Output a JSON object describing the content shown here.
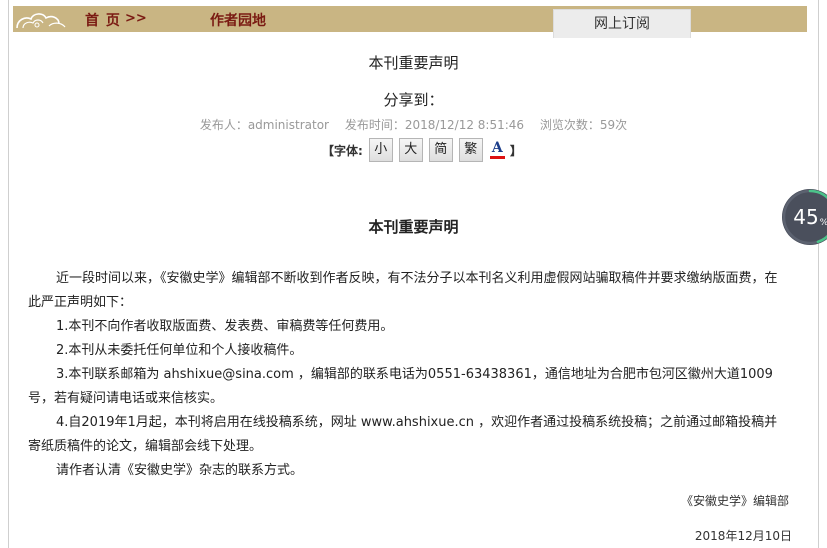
{
  "nav": {
    "home": "首 页",
    "separator": ">>",
    "section": "作者园地",
    "subscribe_tab": "网上订阅"
  },
  "article": {
    "title": "本刊重要声明",
    "share_label": "分享到：",
    "meta": {
      "publisher": "发布人：administrator",
      "publish_time": "发布时间：2018/12/12 8:51:46",
      "views": "浏览次数：59次"
    },
    "font_controls": {
      "open": "【字体:",
      "small": "小",
      "large": "大",
      "simplified": "简",
      "traditional": "繁",
      "color": "A",
      "close": "】"
    },
    "body_title": "本刊重要声明",
    "paragraphs": [
      "近一段时间以来，《安徽史学》编辑部不断收到作者反映，有不法分子以本刊名义利用虚假网站骗取稿件并要求缴纳版面费，在此严正声明如下：",
      "1.本刊不向作者收取版面费、发表费、审稿费等任何费用。",
      "2.本刊从未委托任何单位和个人接收稿件。",
      "3.本刊联系邮箱为 ahshixue@sina.com ，编辑部的联系电话为0551-63438361，通信地址为合肥市包河区徽州大道1009号，若有疑问请电话或来信核实。",
      "4.自2019年1月起，本刊将启用在线投稿系统，网址 www.ahshixue.cn ，欢迎作者通过投稿系统投稿；之前通过邮箱投稿并寄纸质稿件的论文，编辑部会线下处理。",
      "请作者认清《安徽史学》杂志的联系方式。"
    ],
    "signature": "《安徽史学》编辑部",
    "date": "2018年12月10日"
  },
  "progress": {
    "value": "45",
    "unit": "%",
    "fraction": 0.45
  },
  "colors": {
    "nav_bg": "#c9b583",
    "nav_text": "#7a1a12",
    "meta_text": "#999999",
    "progress_bg": "#4a4f5c",
    "progress_arc": "#4cc38a"
  }
}
